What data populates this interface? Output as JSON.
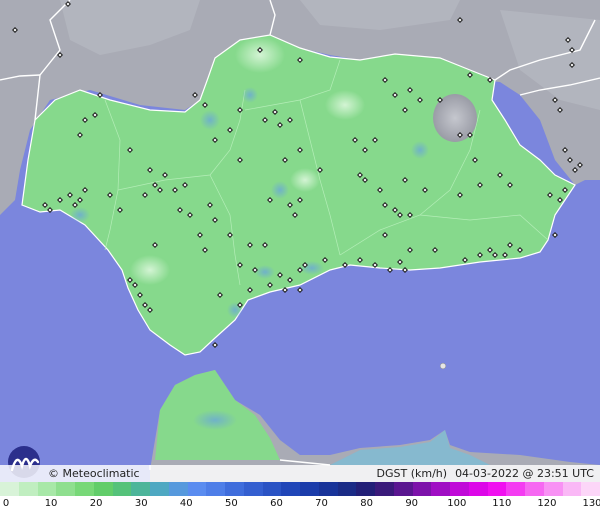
{
  "brand": {
    "name": "Meteoclimatic",
    "symbol": "©"
  },
  "info": {
    "variable": "DGST (km/h)",
    "datetime": "04-03-2022 @ 23:51 UTC"
  },
  "scale": {
    "ticks": [
      "0",
      "10",
      "20",
      "30",
      "40",
      "50",
      "60",
      "70",
      "80",
      "90",
      "100",
      "110",
      "120",
      "130"
    ],
    "colors": [
      "#d8f3d8",
      "#c0eec0",
      "#a8e8a8",
      "#8fdf8f",
      "#78d878",
      "#62cd6a",
      "#55c27a",
      "#4db59a",
      "#4ea8c2",
      "#5699dd",
      "#5a8cf0",
      "#4e7ee8",
      "#3f6ddc",
      "#345fd0",
      "#2a53c4",
      "#2046b8",
      "#1b3caa",
      "#183399",
      "#1a2b86",
      "#221f77",
      "#3a1a7a",
      "#5a1690",
      "#7d12aa",
      "#a00ec4",
      "#c00ad8",
      "#dc06e8",
      "#f010f0",
      "#f43cf2",
      "#f668f2",
      "#f892f4",
      "#fab8f6",
      "#fcd6f8"
    ]
  },
  "colors": {
    "sea": "#7b86dd",
    "neighbor": "#a9abb5",
    "region": "#86d98c",
    "border": "#ffffff",
    "station": "#1a1a1a"
  }
}
